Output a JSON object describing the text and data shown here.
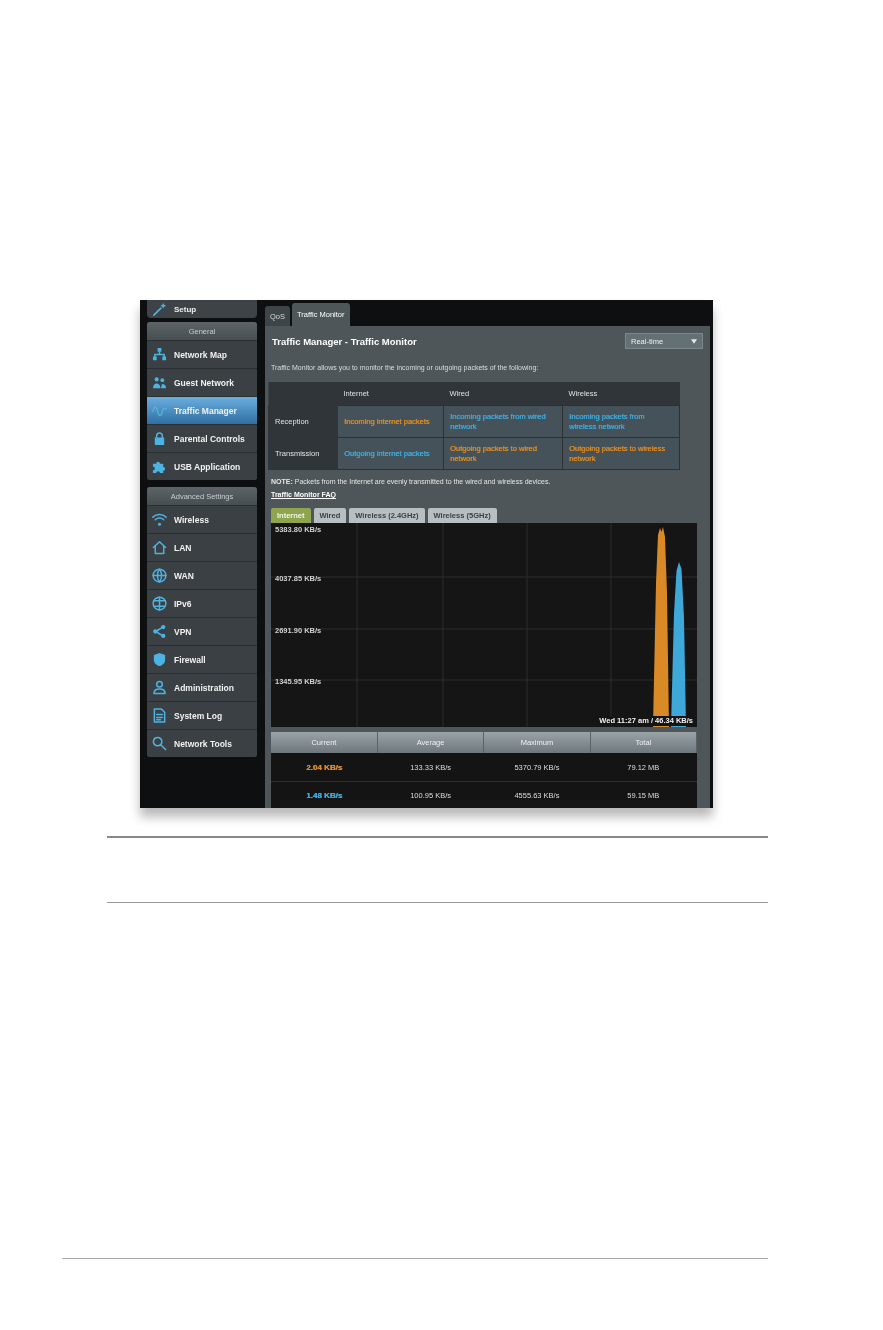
{
  "sidebar": {
    "top_button": {
      "label": "Setup"
    },
    "sections": [
      {
        "title": "General",
        "items": [
          {
            "label": "Network Map",
            "selected": false
          },
          {
            "label": "Guest Network",
            "selected": false
          },
          {
            "label": "Traffic Manager",
            "selected": true
          },
          {
            "label": "Parental Controls",
            "selected": false
          },
          {
            "label": "USB Application",
            "selected": false
          }
        ]
      },
      {
        "title": "Advanced Settings",
        "items": [
          {
            "label": "Wireless",
            "selected": false
          },
          {
            "label": "LAN",
            "selected": false
          },
          {
            "label": "WAN",
            "selected": false
          },
          {
            "label": "IPv6",
            "selected": false
          },
          {
            "label": "VPN",
            "selected": false
          },
          {
            "label": "Firewall",
            "selected": false
          },
          {
            "label": "Administration",
            "selected": false
          },
          {
            "label": "System Log",
            "selected": false
          },
          {
            "label": "Network Tools",
            "selected": false
          }
        ]
      }
    ]
  },
  "tabs": [
    {
      "label": "QoS",
      "selected": false
    },
    {
      "label": "Traffic Monitor",
      "selected": true
    }
  ],
  "panel": {
    "title": "Traffic Manager - Traffic Monitor",
    "view_select": {
      "value": "Real-time"
    },
    "description": "Traffic Monitor allows you to monitor the incoming or outgoing packets of the following:",
    "packet_table": {
      "columns": [
        "Internet",
        "Wired",
        "Wireless"
      ],
      "rows": [
        {
          "label": "Reception",
          "cells": [
            {
              "text": "Incoming internet packets",
              "color": "#d98a26"
            },
            {
              "text": "Incoming packets from wired network",
              "color": "#3ea8d8"
            },
            {
              "text": "Incoming packets from wireless network",
              "color": "#3ea8d8"
            }
          ]
        },
        {
          "label": "Transmission",
          "cells": [
            {
              "text": "Outgoing internet packets",
              "color": "#3ea8d8"
            },
            {
              "text": "Outgoing packets to wired network",
              "color": "#d98a26"
            },
            {
              "text": "Outgoing packets to wireless network",
              "color": "#d98a26"
            }
          ]
        }
      ]
    },
    "note": "**NOTE:** Packets from the Internet are evenly transmitted to the wired and wireless devices.",
    "faq_link": "Traffic Monitor FAQ",
    "chart_tabs": [
      {
        "label": "Internet",
        "selected": true
      },
      {
        "label": "Wired",
        "selected": false
      },
      {
        "label": "Wireless (2.4GHz)",
        "selected": false
      },
      {
        "label": "Wireless (5GHz)",
        "selected": false
      }
    ],
    "chart": {
      "y_labels": [
        "5383.80 KB/s",
        "4037.85 KB/s",
        "2691.90 KB/s",
        "1345.95 KB/s"
      ],
      "readout": "Wed 11:27 am / 46.34 KB/s"
    },
    "stats": {
      "columns": [
        "Current",
        "Average",
        "Maximum",
        "Total"
      ],
      "rows": [
        {
          "color": "#d98a26",
          "cells": [
            "2.04 KB/s",
            "133.33 KB/s",
            "5370.79 KB/s",
            "79.12 MB"
          ]
        },
        {
          "color": "#3ea8d8",
          "cells": [
            "1.48 KB/s",
            "100.95 KB/s",
            "4555.63 KB/s",
            "59.15 MB"
          ]
        }
      ]
    }
  }
}
